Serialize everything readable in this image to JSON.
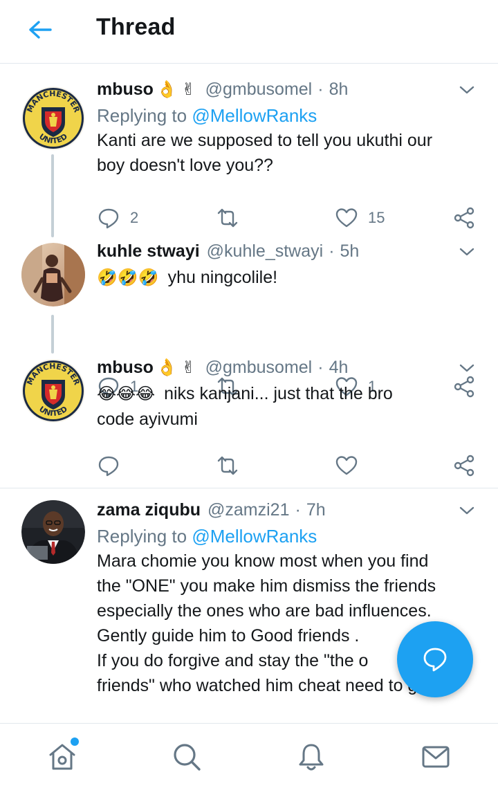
{
  "header": {
    "title": "Thread",
    "back_icon": "arrow-left-icon"
  },
  "colors": {
    "accent": "#1da1f2",
    "muted": "#657786",
    "text": "#14171a",
    "divider": "#e1e8ed"
  },
  "tweets": [
    {
      "name": "mbuso",
      "name_emoji": "👌 ✌",
      "handle": "@gmbusomel",
      "dot": "·",
      "time": "8h",
      "replying_prefix": "Replying to",
      "replying_to": "@MellowRanks",
      "text_1": "Kanti are we supposed to tell you ukuthi our",
      "text_2": "boy doesn't love you??",
      "replies": "2",
      "likes": "15",
      "avatar": "manchester-united-crest"
    },
    {
      "name": "kuhle stwayi",
      "handle": "@kuhle_stwayi",
      "dot": "·",
      "time": "5h",
      "emoji": "🤣🤣🤣",
      "text_1": "yhu ningcolile!",
      "replies": "1",
      "likes": "1",
      "avatar": "user-photo"
    },
    {
      "name": "mbuso",
      "name_emoji": "👌 ✌",
      "handle": "@gmbusomel",
      "dot": "·",
      "time": "4h",
      "emoji": "😂😂😂",
      "text_1": "niks kanjani... just that the bro",
      "text_2": "code ayivumi",
      "avatar": "manchester-united-crest"
    },
    {
      "name": "zama ziqubu",
      "handle": "@zamzi21",
      "dot": "·",
      "time": "7h",
      "replying_prefix": "Replying to",
      "replying_to": "@MellowRanks",
      "text_1": "Mara chomie you know most when you find",
      "text_2": "the \"ONE\" you make him dismiss the friends",
      "text_3": "especially the ones who are bad influences.",
      "text_4": "Gently guide him to Good friends .",
      "text_5": "If you do forgive and stay the \"the o",
      "text_6": "friends\" who watched him cheat need to go.",
      "avatar": "user-photo"
    }
  ],
  "crest": {
    "top": "MANCHESTER",
    "bottom": "UNITED"
  },
  "fab": {
    "icon": "compose-reply-icon"
  },
  "bottom_nav": {
    "items": [
      "home-icon",
      "search-icon",
      "notifications-icon",
      "messages-icon"
    ]
  }
}
